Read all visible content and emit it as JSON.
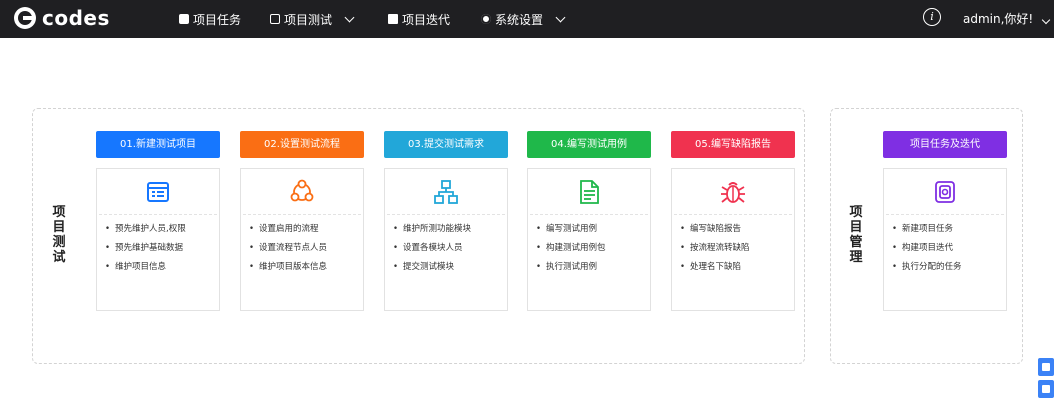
{
  "app": {
    "logo_text": "codes"
  },
  "nav": {
    "items": [
      {
        "label": "项目任务",
        "icon": "briefcase-icon"
      },
      {
        "label": "项目测试",
        "icon": "monitor-icon",
        "dropdown": true
      },
      {
        "label": "项目迭代",
        "icon": "document-icon"
      },
      {
        "label": "系统设置",
        "icon": "gear-icon",
        "dropdown": true
      }
    ],
    "info_icon_text": "i",
    "user_greeting": "admin,你好!"
  },
  "sections": {
    "testing": {
      "label": "项目测试",
      "steps": [
        {
          "title": "01.新建测试项目",
          "color": "#1677ff",
          "icon": "list-window-icon",
          "items": [
            "预先维护人员,权限",
            "预先维护基础数据",
            "维护项目信息"
          ]
        },
        {
          "title": "02.设置测试流程",
          "color": "#fa6e14",
          "icon": "flow-circle-icon",
          "items": [
            "设置启用的流程",
            "设置流程节点人员",
            "维护项目版本信息"
          ]
        },
        {
          "title": "03.提交测试需求",
          "color": "#22a7d9",
          "icon": "org-chart-icon",
          "items": [
            "维护所测功能模块",
            "设置各模块人员",
            "提交测试模块"
          ]
        },
        {
          "title": "04.编写测试用例",
          "color": "#1fb84a",
          "icon": "file-text-icon",
          "items": [
            "编写测试用例",
            "构建测试用例包",
            "执行测试用例"
          ]
        },
        {
          "title": "05.编写缺陷报告",
          "color": "#f0324f",
          "icon": "bug-icon",
          "items": [
            "编写缺陷报告",
            "按流程流转缺陷",
            "处理名下缺陷"
          ]
        }
      ]
    },
    "management": {
      "label": "项目管理",
      "steps": [
        {
          "title": "项目任务及迭代",
          "color": "#7f2fe3",
          "icon": "task-box-icon",
          "items": [
            "新建项目任务",
            "构建项目迭代",
            "执行分配的任务"
          ]
        }
      ]
    }
  }
}
